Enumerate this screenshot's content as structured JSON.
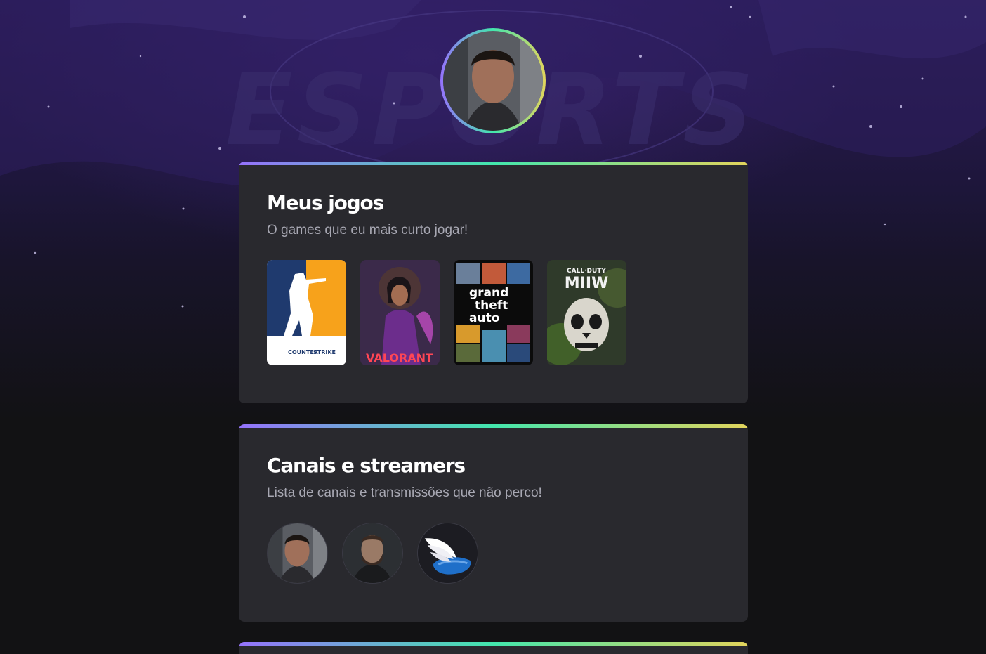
{
  "profile": {
    "avatar_alt": "Foto de perfil"
  },
  "sections": {
    "games": {
      "title": "Meus jogos",
      "subtitle": "O games que eu mais curto jogar!",
      "items": [
        {
          "name": "Counter Strike",
          "logo_text_1": "COUNTER",
          "logo_text_2": "STRIKE"
        },
        {
          "name": "Valorant",
          "logo_text": "VALORANT"
        },
        {
          "name": "Grand Theft Auto V",
          "logo_lines": [
            "grand",
            "theft",
            "auto"
          ]
        },
        {
          "name": "Call of Duty MWII",
          "logo_top": "CALL·DUTY",
          "logo_main": "MIIW"
        }
      ]
    },
    "channels": {
      "title": "Canais e streamers",
      "subtitle": "Lista de canais e transmissões que não perco!"
    }
  },
  "background": {
    "watermark_text": "ESPORTS"
  },
  "colors": {
    "gradient": [
      "#9572FC",
      "#43E7AD",
      "#E2D45C"
    ],
    "card": "#29292E",
    "page": "#121214",
    "subtitle": "#A8A8B3"
  }
}
